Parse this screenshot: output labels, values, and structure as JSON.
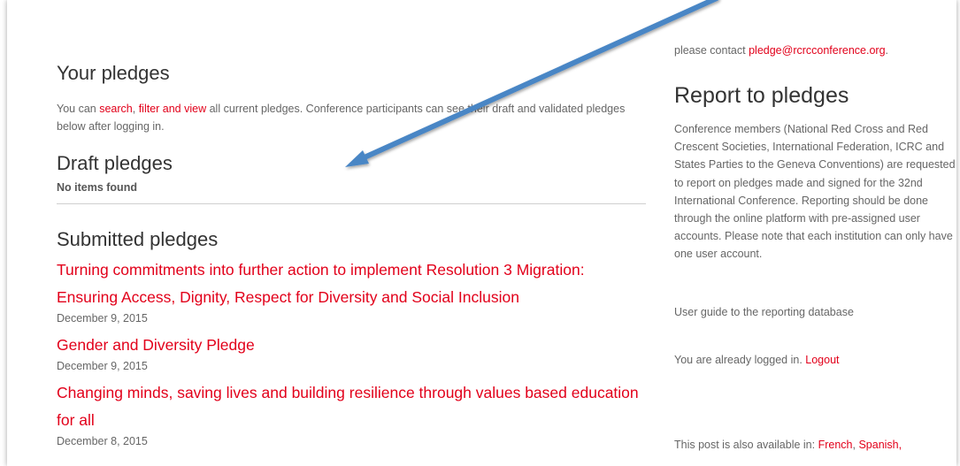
{
  "main": {
    "your_pledges_heading": "Your pledges",
    "intro": {
      "text_before": "You can ",
      "link_search": "search",
      "sep": ", ",
      "link_filter": "filter and view",
      "text_after": " all current pledges. Conference participants can see their draft and validated pledges below after logging in."
    },
    "draft_heading": "Draft pledges",
    "no_items": "No items found",
    "submitted_heading": "Submitted pledges",
    "pledges": [
      {
        "title": "Turning commitments into further action to implement Resolution 3 Migration: Ensuring Access, Dignity, Respect for Diversity and Social Inclusion",
        "date": "December 9, 2015"
      },
      {
        "title": "Gender and Diversity Pledge",
        "date": "December 9, 2015"
      },
      {
        "title": "Changing minds, saving lives and building resilience through values based education for all",
        "date": "December 8, 2015"
      }
    ]
  },
  "sidebar": {
    "contact_prefix": "please contact ",
    "contact_email": "pledge@rcrcconference.org",
    "contact_suffix": ".",
    "report_heading": "Report to pledges",
    "report_text": "Conference members (National Red Cross and Red Crescent Societies, International Federation, ICRC and States Parties to the Geneva Conventions) are requested to report on pledges made and signed for the 32nd International Conference.  Reporting should be done through the online platform with pre-assigned user accounts. Please note that each institution can only have one user account.",
    "guide_link": "User guide to the reporting database",
    "logged_text": "You are already logged in. ",
    "logout_link": "Logout",
    "lang_text": "This post is also available in: ",
    "lang_french": "French",
    "lang_sep": ", ",
    "lang_spanish": "Spanish",
    "lang_trailing": ","
  },
  "colors": {
    "link_red": "#e2001a",
    "arrow_blue": "#4a86c5"
  }
}
